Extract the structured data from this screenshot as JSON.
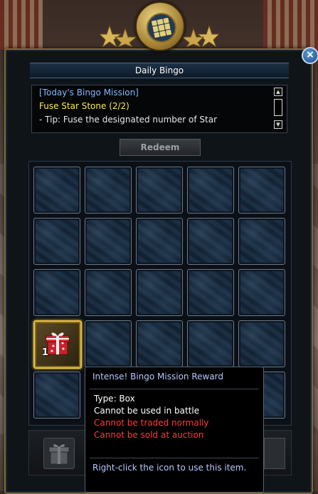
{
  "window": {
    "title": "Daily Bingo",
    "close_label": "×"
  },
  "mission": {
    "heading": "[Today's Bingo Mission]",
    "task": "Fuse Star Stone (2/2)",
    "tip": "- Tip: Fuse the designated number of Star"
  },
  "redeem_label": "Redeem",
  "reward_cell": {
    "quantity": "1"
  },
  "tooltip": {
    "title": "Intense! Bingo Mission Reward",
    "type": "Type: Box",
    "battle": "Cannot be used in battle",
    "trade": "Cannot be traded normally",
    "auction": "Cannot be sold at auction",
    "hint": "Right-click the icon to use this item."
  },
  "colors": {
    "title_text": "#ffffff",
    "mission_heading": "#7fb7ff",
    "mission_task": "#ffe84a",
    "restriction_red": "#ff3a3a",
    "tooltip_blue": "#b8c8ff",
    "reward_border": "#e7c24a"
  },
  "icons": {
    "close": "close-icon",
    "medal": "bingo-medal-icon",
    "gift": "gift-box-icon",
    "scroll_up": "scroll-up-icon",
    "scroll_down": "scroll-down-icon"
  }
}
